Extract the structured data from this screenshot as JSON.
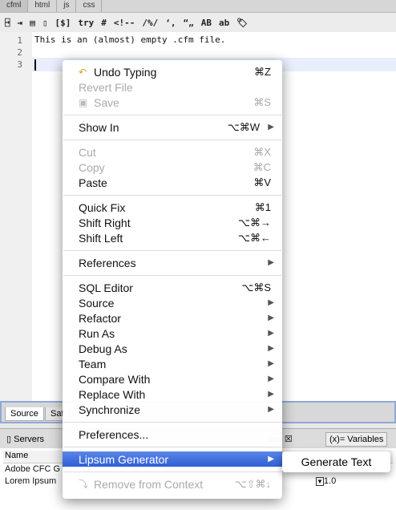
{
  "top_tabs": [
    "cfml",
    "html",
    "js",
    "css"
  ],
  "toolbar": [
    "⍈",
    "⇥",
    "▤",
    "▯",
    "[$]",
    "try",
    "#",
    "<!--",
    "/%/",
    "‘,",
    "“„",
    "AB",
    "ab",
    "🏷"
  ],
  "editor": {
    "line_numbers": [
      "1",
      "2",
      "3"
    ],
    "lines": [
      "This is an (almost) empty .cfm file.",
      "",
      ""
    ]
  },
  "editor_tabs": [
    "Source",
    "Saf"
  ],
  "panel": {
    "tabs": [
      "Servers",
      "ons",
      "(x)= Variables"
    ],
    "header": "Name",
    "rows": [
      "Adobe CFC G",
      "Lorem Ipsum"
    ],
    "version": "1.0"
  },
  "menu": [
    {
      "label": "Undo Typing",
      "shortcut": "⌘Z",
      "icon": "undo-icon"
    },
    {
      "label": "Revert File",
      "disabled": true
    },
    {
      "label": "Save",
      "shortcut": "⌘S",
      "disabled": true,
      "icon": "save-icon"
    },
    {
      "sep": true
    },
    {
      "label": "Show In",
      "shortcut": "⌥⌘W",
      "submenu": true
    },
    {
      "sep": true
    },
    {
      "label": "Cut",
      "shortcut": "⌘X",
      "disabled": true
    },
    {
      "label": "Copy",
      "shortcut": "⌘C",
      "disabled": true
    },
    {
      "label": "Paste",
      "shortcut": "⌘V"
    },
    {
      "sep": true
    },
    {
      "label": "Quick Fix",
      "shortcut": "⌘1"
    },
    {
      "label": "Shift Right",
      "shortcut": "⌥⌘→"
    },
    {
      "label": "Shift Left",
      "shortcut": "⌥⌘←"
    },
    {
      "sep": true
    },
    {
      "label": "References",
      "submenu": true
    },
    {
      "sep": true
    },
    {
      "label": "SQL Editor",
      "shortcut": "⌥⌘S"
    },
    {
      "label": "Source",
      "submenu": true
    },
    {
      "label": "Refactor",
      "submenu": true
    },
    {
      "label": "Run As",
      "submenu": true
    },
    {
      "label": "Debug As",
      "submenu": true
    },
    {
      "label": "Team",
      "submenu": true
    },
    {
      "label": "Compare With",
      "submenu": true
    },
    {
      "label": "Replace With",
      "submenu": true
    },
    {
      "label": "Synchronize",
      "submenu": true
    },
    {
      "sep": true
    },
    {
      "label": "Preferences..."
    },
    {
      "sep": true
    },
    {
      "label": "Lipsum Generator",
      "submenu": true,
      "highlighted": true
    },
    {
      "sep": true
    },
    {
      "label": "Remove from Context",
      "shortcut": "⌥⇧⌘↓",
      "disabled": true,
      "icon": "remove-context-icon"
    }
  ],
  "submenu": {
    "label": "Generate Text"
  },
  "colors": {
    "highlight": "#3a6ad9"
  }
}
